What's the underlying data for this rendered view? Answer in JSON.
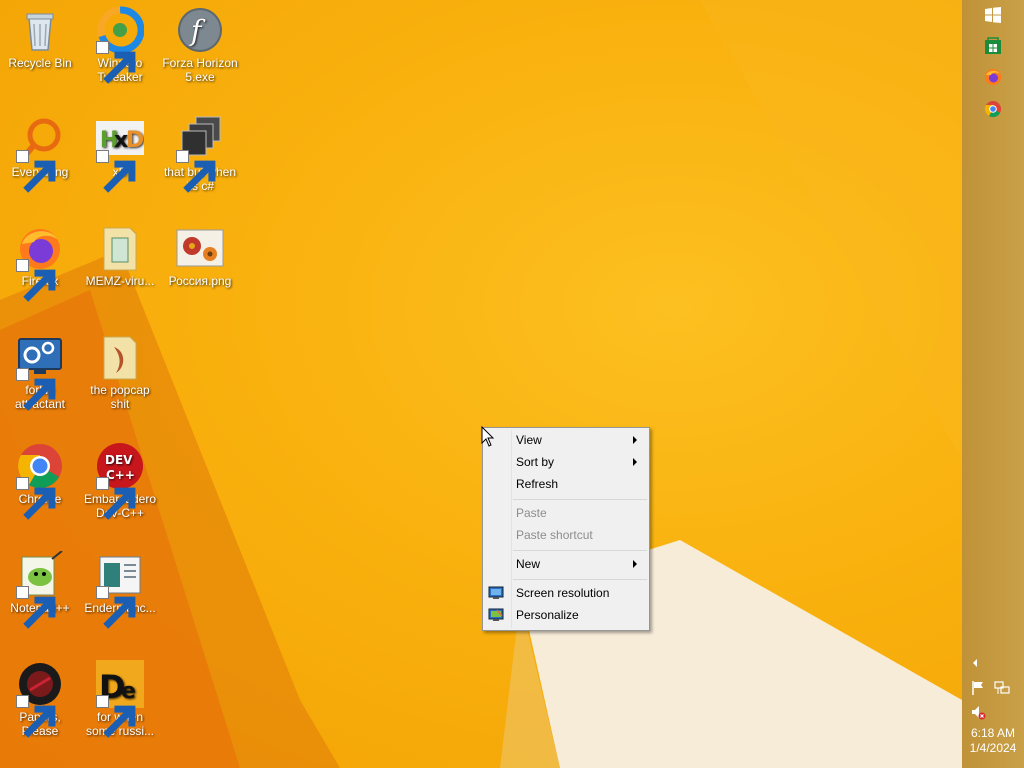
{
  "desktop": {
    "icons": [
      {
        "label": "Recycle Bin",
        "icon": "recycle-bin-icon"
      },
      {
        "label": "Winaero Tweaker",
        "icon": "winaero-tweaker-icon"
      },
      {
        "label": "Forza Horizon 5.exe",
        "icon": "flash-player-icon"
      },
      {
        "label": "Everything",
        "icon": "everything-search-icon"
      },
      {
        "label": "xD",
        "icon": "hxd-icon"
      },
      {
        "label": "that but when its c#",
        "icon": "stacked-windows-icon"
      },
      {
        "label": "Firefox",
        "icon": "firefox-icon"
      },
      {
        "label": "MEMZ-viru...",
        "icon": "folder-icon"
      },
      {
        "label": "Россия.png",
        "icon": "image-file-icon"
      },
      {
        "label": "forkie attractant",
        "icon": "settings-monitor-icon"
      },
      {
        "label": "the popcap shit",
        "icon": "folder-icon"
      },
      {
        "label": "Chrome",
        "icon": "chrome-icon"
      },
      {
        "label": "Embarcadero Dev-C++",
        "icon": "dev-cpp-icon"
      },
      {
        "label": "Notepad++",
        "icon": "notepad-plus-plus-icon"
      },
      {
        "label": "Endermanc...",
        "icon": "document-window-icon"
      },
      {
        "label": "Papers, Please",
        "icon": "papers-please-icon"
      },
      {
        "label": "for when some russi...",
        "icon": "de-icon"
      }
    ]
  },
  "context_menu": {
    "items": {
      "view": "View",
      "sort_by": "Sort by",
      "refresh": "Refresh",
      "paste": "Paste",
      "paste_shortcut": "Paste shortcut",
      "new": "New",
      "screen_resolution": "Screen resolution",
      "personalize": "Personalize"
    }
  },
  "taskbar": {
    "pinned": [
      "windows-start-icon",
      "store-icon",
      "firefox-icon",
      "chrome-icon"
    ],
    "tray": [
      "show-hidden-icons-chevron",
      "action-center-flag-icon",
      "network-icon",
      "volume-muted-icon"
    ],
    "time": "6:18 AM",
    "date": "1/4/2024"
  },
  "colors": {
    "wallpaper": "#f9b10e",
    "taskbar": "#c49a3c",
    "menu_bg": "#f0f0f0"
  }
}
